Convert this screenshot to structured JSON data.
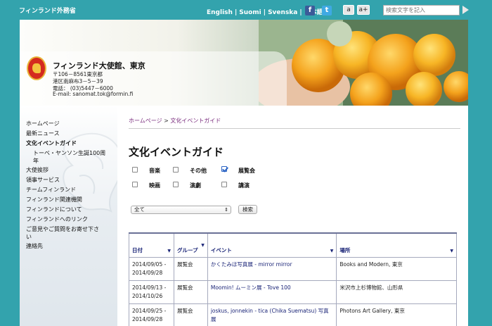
{
  "header": {
    "ministry": "フィンランド外務省",
    "languages": [
      "English",
      "Suomi",
      "Svenska",
      "日本語"
    ],
    "facebook_icon": "f",
    "twitter_icon": "t",
    "font_small": "a",
    "font_large": "a+",
    "search_placeholder": "検索文字を記入"
  },
  "banner": {
    "embassy_name": "フィンランド大使館、東京",
    "address_lines": [
      "〒106－8561東京都",
      "港区南麻布3－5－39",
      "電話： (03)5447－6000",
      "E-mail: sanomat.tok@formin.fi"
    ]
  },
  "sidebar": {
    "items": [
      {
        "label": "ホームページ",
        "active": false
      },
      {
        "label": "最新ニュース",
        "active": false
      },
      {
        "label": "文化イベントガイド",
        "active": true
      },
      {
        "label": "トーベ・ヤンソン生誕100周",
        "active": false,
        "sub": true
      },
      {
        "label": "年",
        "active": false,
        "sub": true
      },
      {
        "label": "大使挨拶",
        "active": false
      },
      {
        "label": "領事サービス",
        "active": false
      },
      {
        "label": "チームフィンランド",
        "active": false
      },
      {
        "label": "フィンランド関連機関",
        "active": false
      },
      {
        "label": "フィンランドについて",
        "active": false
      },
      {
        "label": "フィンランドへのリンク",
        "active": false
      },
      {
        "label": "ご意見やご質問をお寄せ下さ",
        "active": false
      },
      {
        "label": "い",
        "active": false
      },
      {
        "label": "連絡先",
        "active": false
      }
    ]
  },
  "main": {
    "breadcrumb_home": "ホームページ",
    "breadcrumb_sep": " > ",
    "breadcrumb_current": "文化イベントガイド",
    "title": "文化イベントガイド",
    "filters": [
      {
        "label": "音楽",
        "checked": false
      },
      {
        "label": "その他",
        "checked": false
      },
      {
        "label": "展覧会",
        "checked": true
      },
      {
        "label": "映画",
        "checked": false
      },
      {
        "label": "演劇",
        "checked": false
      },
      {
        "label": "講演",
        "checked": false
      }
    ],
    "select_value": "全て",
    "search_button": "検索",
    "table": {
      "headers": [
        "日付",
        "グループ",
        "イベント",
        "場所"
      ],
      "rows": [
        {
          "date": "2014/09/05 - 2014/09/28",
          "group": "展覧会",
          "event": "かくたみほ写真展 - mirror mirror",
          "place": "Books and Modern, 東京"
        },
        {
          "date": "2014/09/13 - 2014/10/26",
          "group": "展覧会",
          "event": "Moomin! ムーミン展 - Tove 100",
          "place": "米沢市上杉博物館、山形県"
        },
        {
          "date": "2014/09/25 - 2014/09/28",
          "group": "展覧会",
          "event": "joskus, jonnekin - tica (Chika Suematsu) 写真展",
          "place": "Photons Art Gallery, 東京"
        }
      ]
    }
  }
}
